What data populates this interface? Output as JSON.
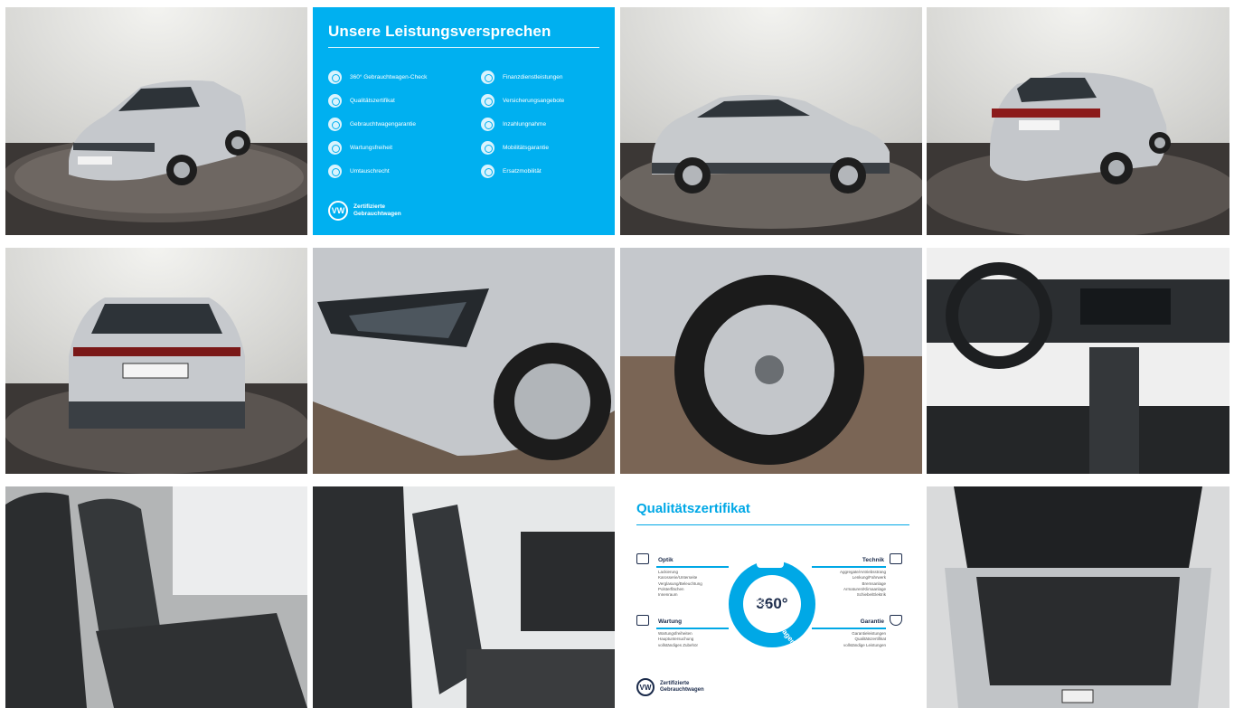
{
  "gallery": {
    "photos": [
      {
        "subject": "front-left-three-quarter view, showroom turntable",
        "plate": "BLK A 7805"
      },
      {
        "subject": "side profile view, showroom turntable"
      },
      {
        "subject": "rear-right-three-quarter view, showroom turntable",
        "plate": "BLK A 7805"
      },
      {
        "subject": "rear view, showroom turntable",
        "plate": "BLK A 7805"
      },
      {
        "subject": "headlight and front wheel detail"
      },
      {
        "subject": "alloy wheel detail"
      },
      {
        "subject": "cockpit and dashboard"
      },
      {
        "subject": "rear seats"
      },
      {
        "subject": "front seats"
      },
      {
        "subject": "open trunk"
      }
    ]
  },
  "promise": {
    "title": "Unsere Leistungsversprechen",
    "left_items": [
      "360° Gebrauchtwagen-Check",
      "Qualitätszertifikat",
      "Gebrauchtwagengarantie",
      "Wartungsfreiheit",
      "Umtauschrecht"
    ],
    "right_items": [
      "Finanzdienstleistungen",
      "Versicherungsangebote",
      "Inzahlungnahme",
      "Mobilitätsgarantie",
      "Ersatzmobilität"
    ],
    "brand_line1": "Zertifizierte",
    "brand_line2": "Gebrauchtwagen",
    "logo": "VW",
    "color": "#00b0f0"
  },
  "certificate": {
    "title": "Qualitätszertifikat",
    "hub_label": "360°",
    "hub_ring_text": "Gebrauchtwagen-Check",
    "optik": {
      "title": "Optik",
      "items": [
        "Lackierung",
        "Karosserie/Unterseite",
        "Verglasung/Beleuchtung",
        "Polsterflächen",
        "Innenraum"
      ]
    },
    "technik": {
      "title": "Technik",
      "items": [
        "Aggregate/Antriebsstrang",
        "Lenkung/Fahrwerk",
        "Bremsanlage",
        "Armaturen/Klimaanlage",
        "Schiebe/Elektrik"
      ]
    },
    "wartung": {
      "title": "Wartung",
      "items": [
        "Wartungsfreiheiten",
        "Hauptuntersuchung",
        "vollständiges Zubehör"
      ]
    },
    "garantie": {
      "title": "Garantie",
      "items": [
        "Garantieleistungen",
        "Qualitätszertifikat",
        "vollständige Leistungen"
      ]
    },
    "brand_line1": "Zertifizierte",
    "brand_line2": "Gebrauchtwagen",
    "logo": "VW",
    "accent": "#00a8e6"
  }
}
